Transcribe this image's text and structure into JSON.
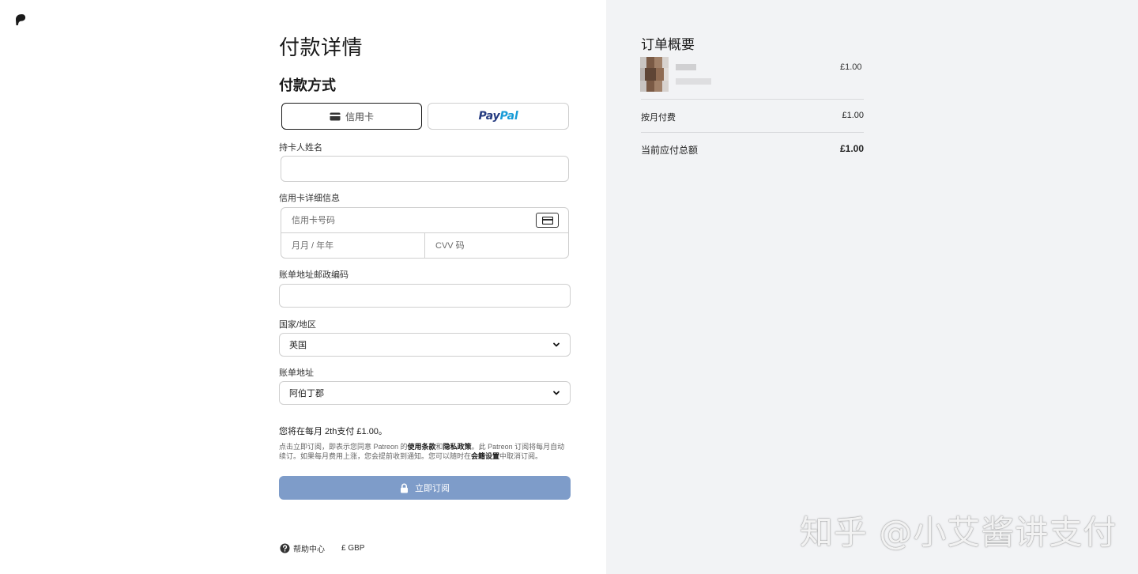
{
  "form": {
    "page_title": "付款详情",
    "section_title": "付款方式",
    "methods": {
      "card_label": "信用卡",
      "paypal_pay": "Pay",
      "paypal_pal": "Pal"
    },
    "cardholder_label": "持卡人姓名",
    "cardholder_value": "",
    "card_details_label": "信用卡详细信息",
    "card_number_placeholder": "信用卡号码",
    "expiry_placeholder": "月月 / 年年",
    "cvv_placeholder": "CVV 码",
    "postcode_label": "账单地址邮政编码",
    "postcode_value": "",
    "country_label": "国家/地区",
    "country_value": "英国",
    "billing_address_label": "账单地址",
    "billing_address_value": "阿伯丁郡",
    "pay_note": "您将在每月 2th支付 £1.00。",
    "legal": {
      "part1": "点击立即订阅，即表示您同意 Patreon 的",
      "terms": "使用条款",
      "and": "和",
      "privacy": "隐私政策",
      "part2": "。此 Patreon 订阅将每月自动续订。如果每月费用上涨，您会提前收到通知。您可以随时在",
      "settings": "会籍设置",
      "part3": "中取消订阅。"
    },
    "subscribe_label": "立即订阅"
  },
  "footer": {
    "help_label": "帮助中心",
    "currency_label": "£ GBP"
  },
  "summary": {
    "title": "订单概要",
    "item_price": "£1.00",
    "monthly_label": "按月付费",
    "monthly_value": "£1.00",
    "total_label": "当前应付总额",
    "total_value": "£1.00"
  },
  "watermark": "知乎 @小艾酱讲支付",
  "colors": {
    "subscribe_button": "#7e9cc9",
    "right_panel_bg": "#f2f3f5",
    "paypal_blue_dark": "#253b80",
    "paypal_blue_light": "#179bd7"
  }
}
